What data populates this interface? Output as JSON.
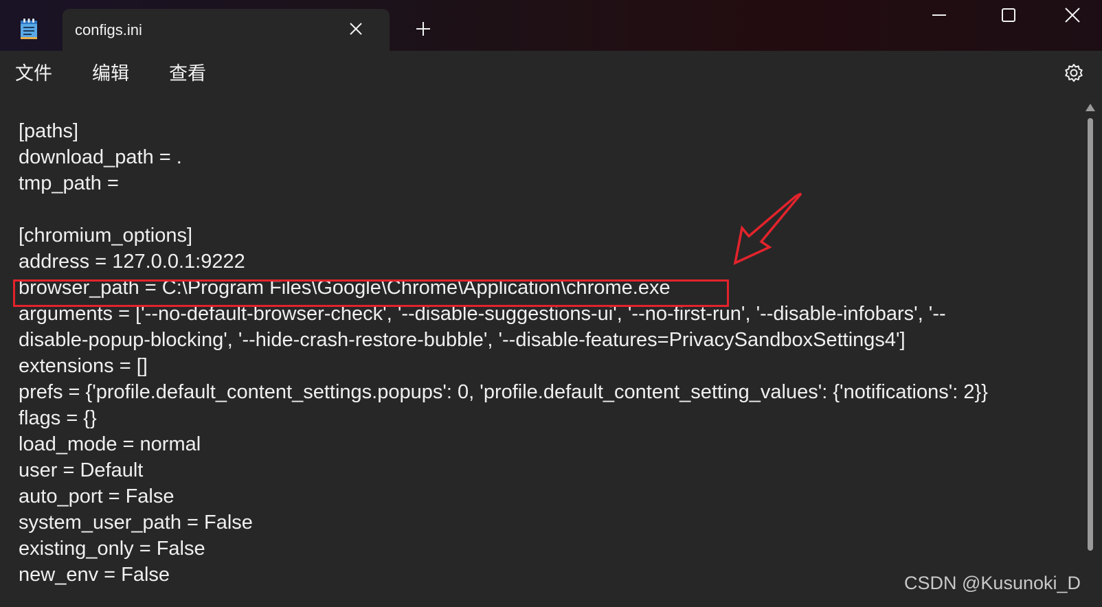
{
  "window": {
    "tab_title": "configs.ini"
  },
  "menu": {
    "file": "文件",
    "edit": "编辑",
    "view": "查看"
  },
  "icons": {
    "app": "notepad-icon",
    "tab_close": "close-icon",
    "new_tab": "plus-icon",
    "minimize": "minimize-icon",
    "maximize": "maximize-icon",
    "close": "close-icon",
    "settings": "gear-icon",
    "scroll_up": "triangle-up-icon"
  },
  "editor": {
    "lines": [
      "[paths]",
      "download_path = .",
      "tmp_path =",
      "",
      "[chromium_options]",
      "address = 127.0.0.1:9222",
      "browser_path = C:\\Program Files\\Google\\Chrome\\Application\\chrome.exe",
      "arguments = ['--no-default-browser-check', '--disable-suggestions-ui', '--no-first-run', '--disable-infobars', '--",
      "disable-popup-blocking', '--hide-crash-restore-bubble', '--disable-features=PrivacySandboxSettings4']",
      "extensions = []",
      "prefs = {'profile.default_content_settings.popups': 0, 'profile.default_content_setting_values': {'notifications': 2}}",
      "flags = {}",
      "load_mode = normal",
      "user = Default",
      "auto_port = False",
      "system_user_path = False",
      "existing_only = False",
      "new_env = False"
    ]
  },
  "annotation": {
    "color": "#e3232c"
  },
  "watermark": "CSDN @Kusunoki_D",
  "colors": {
    "background": "#272727",
    "text": "#f0f0f0"
  }
}
